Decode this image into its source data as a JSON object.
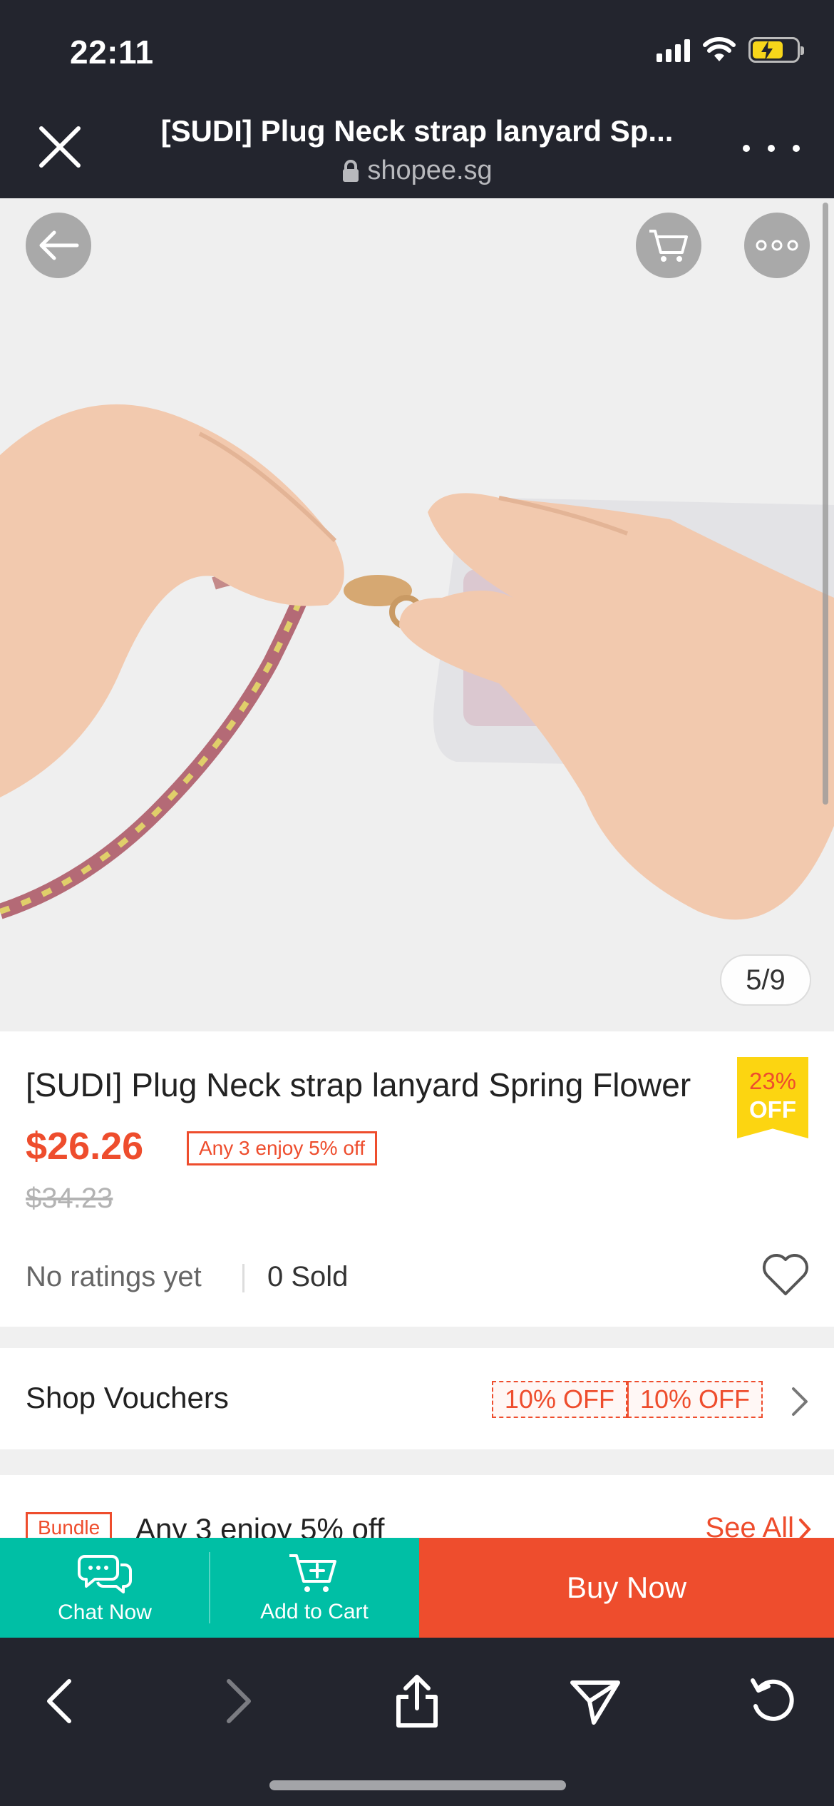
{
  "status_bar": {
    "time": "22:11"
  },
  "browser": {
    "title": "[SUDI] Plug Neck strap lanyard Sp...",
    "url": "shopee.sg"
  },
  "gallery": {
    "page_indicator": "5/9"
  },
  "product": {
    "title": "[SUDI] Plug Neck strap lanyard Spring Flower",
    "discount_pct": "23%",
    "discount_off": "OFF",
    "price": "$26.26",
    "promo_badge": "Any 3 enjoy 5% off",
    "original_price": "$34.23",
    "ratings": "No ratings yet",
    "sold": "0 Sold"
  },
  "vouchers": {
    "label": "Shop Vouchers",
    "tags": [
      "10% OFF",
      "10% OFF"
    ]
  },
  "bundle": {
    "badge": "Bundle",
    "text": "Any 3 enjoy 5% off",
    "see_all": "See All"
  },
  "actions": {
    "chat": "Chat Now",
    "cart": "Add to Cart",
    "buy": "Buy Now"
  },
  "colors": {
    "brand_orange": "#ee4d2d",
    "teal": "#00bfa5",
    "discount_yellow": "#fcd511",
    "chrome_dark": "#23252e"
  },
  "icons": {
    "close": "close-icon",
    "more": "more-dots-icon",
    "back": "back-arrow-icon",
    "cart": "cart-icon",
    "options": "more-dots-icon",
    "heart": "heart-icon",
    "chat": "chat-bubbles-icon",
    "add_cart": "cart-plus-icon",
    "share": "share-icon",
    "send": "send-icon",
    "reload": "reload-icon"
  }
}
